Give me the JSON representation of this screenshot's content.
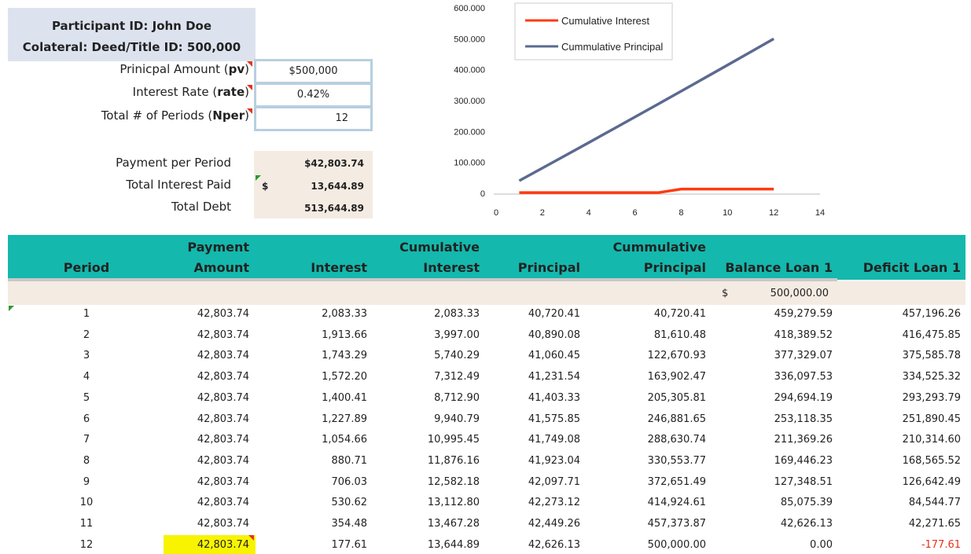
{
  "participant": {
    "id_line": "Participant ID:  John Doe",
    "collateral_line": "Colateral: Deed/Title ID: 500,000"
  },
  "inputs": {
    "pv_label_pre": "Prinicpal Amount (",
    "pv_label_bold": "pv",
    "pv_label_post": ")",
    "pv_value": "$500,000",
    "rate_label_pre": "Interest Rate (",
    "rate_label_bold": "rate",
    "rate_label_post": ")",
    "rate_value": "0.42%",
    "nper_label_pre": "Total # of Periods (",
    "nper_label_bold": "Nper",
    "nper_label_post": ")",
    "nper_value": "12"
  },
  "outputs": {
    "payment_label": "Payment per Period",
    "payment_value": "$42,803.74",
    "interest_label": "Total Interest Paid",
    "interest_currency": "$",
    "interest_value": "13,644.89",
    "debt_label": "Total Debt",
    "debt_value": "513,644.89"
  },
  "chart_data": {
    "type": "line",
    "legend": [
      "Cumulative Interest",
      "Cummulative Principal"
    ],
    "legend_placement": "top-left",
    "xlim": [
      0,
      14
    ],
    "ylim": [
      0,
      600000
    ],
    "x_ticks": [
      "0",
      "2",
      "4",
      "6",
      "8",
      "10",
      "12",
      "14"
    ],
    "y_ticks": [
      "0",
      "100.000",
      "200.000",
      "300.000",
      "400.000",
      "500.000",
      "600.000"
    ],
    "series": [
      {
        "name": "Cumulative Interest",
        "color": "#ff3a10",
        "x": [
          1,
          2,
          3,
          4,
          5,
          6,
          7,
          8,
          9,
          10,
          11,
          12
        ],
        "y": [
          2083.33,
          2083.33,
          2083.33,
          2083.33,
          2083.33,
          2083.33,
          2083.33,
          13644.89,
          13644.89,
          13644.89,
          13644.89,
          13644.89
        ]
      },
      {
        "name": "Cummulative Principal",
        "color": "#5b6a8f",
        "x": [
          1,
          2,
          3,
          4,
          5,
          6,
          7,
          8,
          9,
          10,
          11,
          12
        ],
        "y": [
          40720.41,
          81610.48,
          122670.93,
          163902.47,
          205305.81,
          246881.65,
          288630.74,
          330553.77,
          372651.49,
          414924.61,
          457373.87,
          500000
        ]
      }
    ]
  },
  "table": {
    "headers": {
      "period": [
        "",
        "Period"
      ],
      "payment": [
        "Payment",
        "Amount"
      ],
      "interest": [
        "",
        "Interest"
      ],
      "cum_interest": [
        "Cumulative",
        "Interest"
      ],
      "principal": [
        "",
        "Principal"
      ],
      "cum_principal": [
        "Cummulative",
        "Principal"
      ],
      "balance": [
        "",
        "Balance Loan 1"
      ],
      "deficit": [
        "",
        "Deficit Loan 1"
      ]
    },
    "opening_currency": "$",
    "opening_balance": "500,000.00",
    "rows": [
      [
        "1",
        "42,803.74",
        "2,083.33",
        "2,083.33",
        "40,720.41",
        "40,720.41",
        "459,279.59",
        "457,196.26"
      ],
      [
        "2",
        "42,803.74",
        "1,913.66",
        "3,997.00",
        "40,890.08",
        "81,610.48",
        "418,389.52",
        "416,475.85"
      ],
      [
        "3",
        "42,803.74",
        "1,743.29",
        "5,740.29",
        "41,060.45",
        "122,670.93",
        "377,329.07",
        "375,585.78"
      ],
      [
        "4",
        "42,803.74",
        "1,572.20",
        "7,312.49",
        "41,231.54",
        "163,902.47",
        "336,097.53",
        "334,525.32"
      ],
      [
        "5",
        "42,803.74",
        "1,400.41",
        "8,712.90",
        "41,403.33",
        "205,305.81",
        "294,694.19",
        "293,293.79"
      ],
      [
        "6",
        "42,803.74",
        "1,227.89",
        "9,940.79",
        "41,575.85",
        "246,881.65",
        "253,118.35",
        "251,890.45"
      ],
      [
        "7",
        "42,803.74",
        "1,054.66",
        "10,995.45",
        "41,749.08",
        "288,630.74",
        "211,369.26",
        "210,314.60"
      ],
      [
        "8",
        "42,803.74",
        "880.71",
        "11,876.16",
        "41,923.04",
        "330,553.77",
        "169,446.23",
        "168,565.52"
      ],
      [
        "9",
        "42,803.74",
        "706.03",
        "12,582.18",
        "42,097.71",
        "372,651.49",
        "127,348.51",
        "126,642.49"
      ],
      [
        "10",
        "42,803.74",
        "530.62",
        "13,112.80",
        "42,273.12",
        "414,924.61",
        "85,075.39",
        "84,544.77"
      ],
      [
        "11",
        "42,803.74",
        "354.48",
        "13,467.28",
        "42,449.26",
        "457,373.87",
        "42,626.13",
        "42,271.65"
      ],
      [
        "12",
        "42,803.74",
        "177.61",
        "13,644.89",
        "42,626.13",
        "500,000.00",
        "0.00",
        "-177.61"
      ]
    ],
    "colors": {
      "header_bg": "#14b8ad",
      "negative": "#e5331b",
      "highlight": "#f8f400"
    }
  }
}
